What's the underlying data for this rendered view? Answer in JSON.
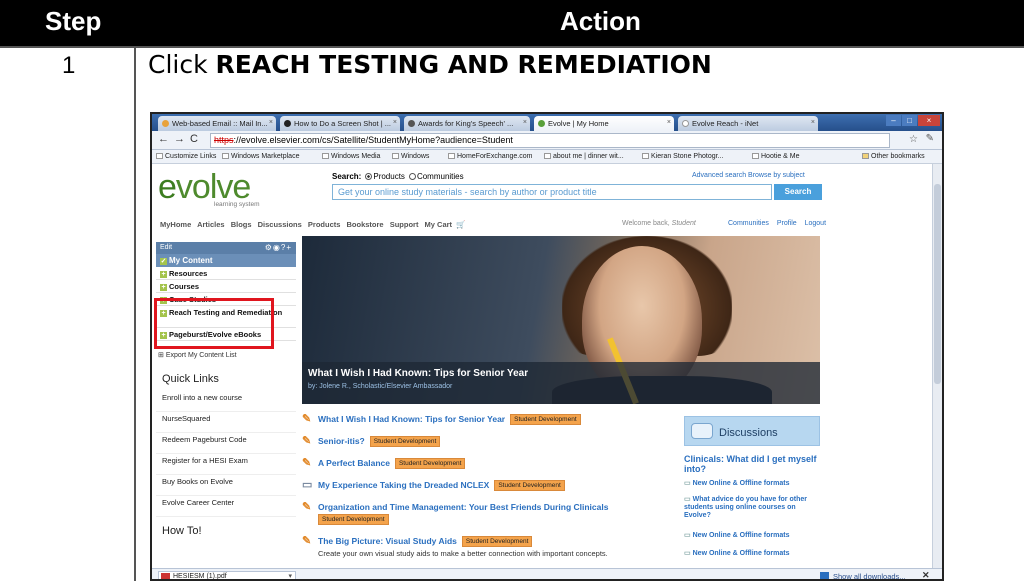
{
  "table": {
    "step_header": "Step",
    "action_header": "Action",
    "step_number": "1",
    "instruction_prefix": "Click ",
    "instruction_bold": "REACH TESTING AND REMEDIATION"
  },
  "browser": {
    "tabs": [
      {
        "label": "Web-based Email :: Mail In...",
        "active": false,
        "color": "#e8a23a"
      },
      {
        "label": "How to Do a Screen Shot | ...",
        "active": false,
        "color": "#222"
      },
      {
        "label": "Awards for King's Speech' ...",
        "active": false,
        "color": "#555"
      },
      {
        "label": "Evolve | My Home",
        "active": true,
        "color": "#5aa03a"
      },
      {
        "label": "Evolve Reach - iNet",
        "active": false,
        "color": "#fff"
      }
    ],
    "url_https": "https",
    "url_rest": "://evolve.elsevier.com/cs/Satellite/StudentMyHome?audience=Student",
    "bookmarks": [
      "Customize Links",
      "Windows Marketplace",
      "Windows Media",
      "Windows",
      "HomeForExchange.com",
      "about me | dinner wit...",
      "Kieran Stone Photogr...",
      "Hootie & Me",
      "Other bookmarks"
    ],
    "download_file": "HESIESM (1).pdf",
    "show_all_downloads": "Show all downloads..."
  },
  "site": {
    "logo_text": "volve",
    "logo_sub": "learning system",
    "search_label": "Search:",
    "search_opt1": "Products",
    "search_opt2": "Communities",
    "search_placeholder": "Get your online study materials - search by author or product title",
    "search_button": "Search",
    "advanced": "Advanced search   Browse by subject",
    "nav": [
      "MyHome",
      "Articles",
      "Blogs",
      "Discussions",
      "Products",
      "Bookstore",
      "Support",
      "My Cart"
    ],
    "welcome_prefix": "Welcome back, ",
    "welcome_name": "Student",
    "top_links": [
      "Communities",
      "Profile",
      "Logout"
    ],
    "edit_label": "Edit",
    "my_content": "My Content",
    "side_items": [
      "Resources",
      "Courses",
      "Case Studies",
      "Reach Testing and Remediation",
      "Pageburst/Evolve eBooks"
    ],
    "export": "Export My Content List",
    "quick_links_title": "Quick Links",
    "quick_links": [
      "Enroll into a new course",
      "NurseSquared",
      "Redeem Pageburst Code",
      "Register for a HESI Exam",
      "Buy Books on Evolve",
      "Evolve Career Center"
    ],
    "howto_title": "How To!",
    "hero_title": "What I Wish I Had Known: Tips for Senior Year",
    "hero_by": "by: Jolene R., Scholastic/Elsevier Ambassador",
    "articles": [
      {
        "title": "What I Wish I Had Known: Tips for Senior Year",
        "tag": "Student Development",
        "sub": ""
      },
      {
        "title": "Senior-itis?",
        "tag": "Student Development",
        "sub": ""
      },
      {
        "title": "A Perfect Balance",
        "tag": "Student Development",
        "sub": ""
      },
      {
        "title": "My Experience Taking the Dreaded NCLEX",
        "tag": "Student Development",
        "sub": ""
      },
      {
        "title": "Organization and Time Management: Your Best Friends During Clinicals",
        "tag": "Student Development",
        "sub": ""
      },
      {
        "title": "The Big Picture: Visual Study Aids",
        "tag": "Student Development",
        "sub": "Create your own visual study aids to make a better connection with important concepts."
      }
    ],
    "discussions_title": "Discussions",
    "clinicals": "Clinicals: What did I get myself into?",
    "disc_links": [
      "New Online & Offline formats",
      "What advice do you have for other students using online courses on Evolve?",
      "New Online & Offline formats",
      "New Online & Offline formats"
    ]
  },
  "colors": {
    "highlight_box": "#e0151e",
    "brand_green": "#4e8a2d",
    "link_blue": "#2a6fbf",
    "tag_orange": "#f4a34b"
  }
}
